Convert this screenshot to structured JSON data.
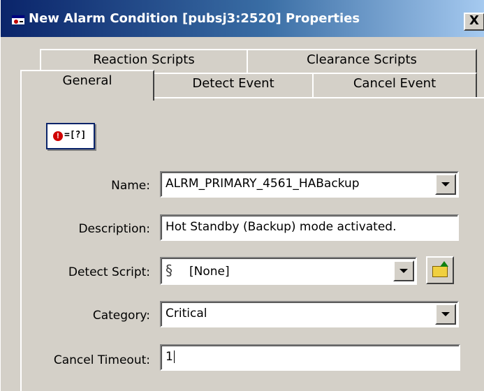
{
  "window": {
    "title": "New Alarm Condition [pubsj3:2520] Properties",
    "close_label": "X"
  },
  "tabs": {
    "back_row": [
      "Reaction Scripts",
      "Clearance Scripts"
    ],
    "front_row": [
      "General",
      "Detect Event",
      "Cancel Event"
    ],
    "selected": "General"
  },
  "general": {
    "icon_text": "=[?]",
    "icon_mark": "!",
    "name": {
      "label": "Name:",
      "value": "ALRM_PRIMARY_4561_HABackup"
    },
    "description": {
      "label": "Description:",
      "value": "Hot Standby (Backup) mode activated."
    },
    "detect_script": {
      "label": "Detect Script:",
      "value": "[None]"
    },
    "category": {
      "label": "Category:",
      "value": "Critical"
    },
    "cancel_timeout": {
      "label": "Cancel Timeout:",
      "value": "1"
    }
  },
  "icons": [
    "app-alarm-icon",
    "close-icon",
    "alarm-condition-icon",
    "chevron-down-icon",
    "script-icon",
    "browse-folder-icon"
  ],
  "colors": {
    "title_start": "#0a246a",
    "title_end": "#a6caf0",
    "face": "#d4d0c8"
  }
}
